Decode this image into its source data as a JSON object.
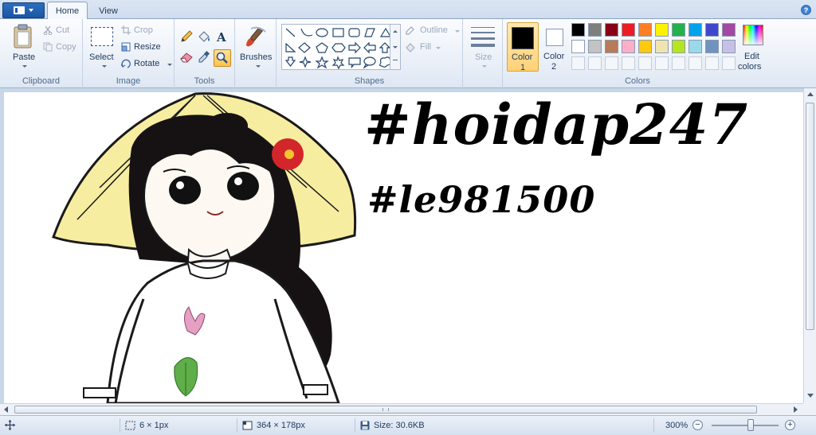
{
  "tabs": {
    "home": "Home",
    "view": "View"
  },
  "clipboard": {
    "paste": "Paste",
    "cut": "Cut",
    "copy": "Copy",
    "label": "Clipboard"
  },
  "image": {
    "select": "Select",
    "crop": "Crop",
    "resize": "Resize",
    "rotate": "Rotate",
    "label": "Image"
  },
  "tools": {
    "label": "Tools"
  },
  "brushes": {
    "label": "Brushes"
  },
  "shapes": {
    "outline": "Outline",
    "fill": "Fill",
    "label": "Shapes"
  },
  "size": {
    "label": "Size"
  },
  "colors": {
    "color1_line1": "Color",
    "color1_line2": "1",
    "color2_line1": "Color",
    "color2_line2": "2",
    "edit_line1": "Edit",
    "edit_line2": "colors",
    "label": "Colors",
    "color1_value": "#000000",
    "color2_value": "#ffffff",
    "row1": [
      "#000000",
      "#7f7f7f",
      "#880015",
      "#ed1c24",
      "#ff7f27",
      "#fff200",
      "#22b14c",
      "#00a2e8",
      "#3f48cc",
      "#a349a4"
    ],
    "row2": [
      "#ffffff",
      "#c3c3c3",
      "#b97a57",
      "#ffaec9",
      "#ffc90e",
      "#efe4b0",
      "#b5e61d",
      "#99d9ea",
      "#7092be",
      "#c8bfe7"
    ]
  },
  "canvas": {
    "text1": "#hoidap247",
    "text2": "#le981500"
  },
  "status": {
    "selection": "6 × 1px",
    "dimensions": "364 × 178px",
    "size": "Size: 30.6KB",
    "zoom": "300%"
  }
}
